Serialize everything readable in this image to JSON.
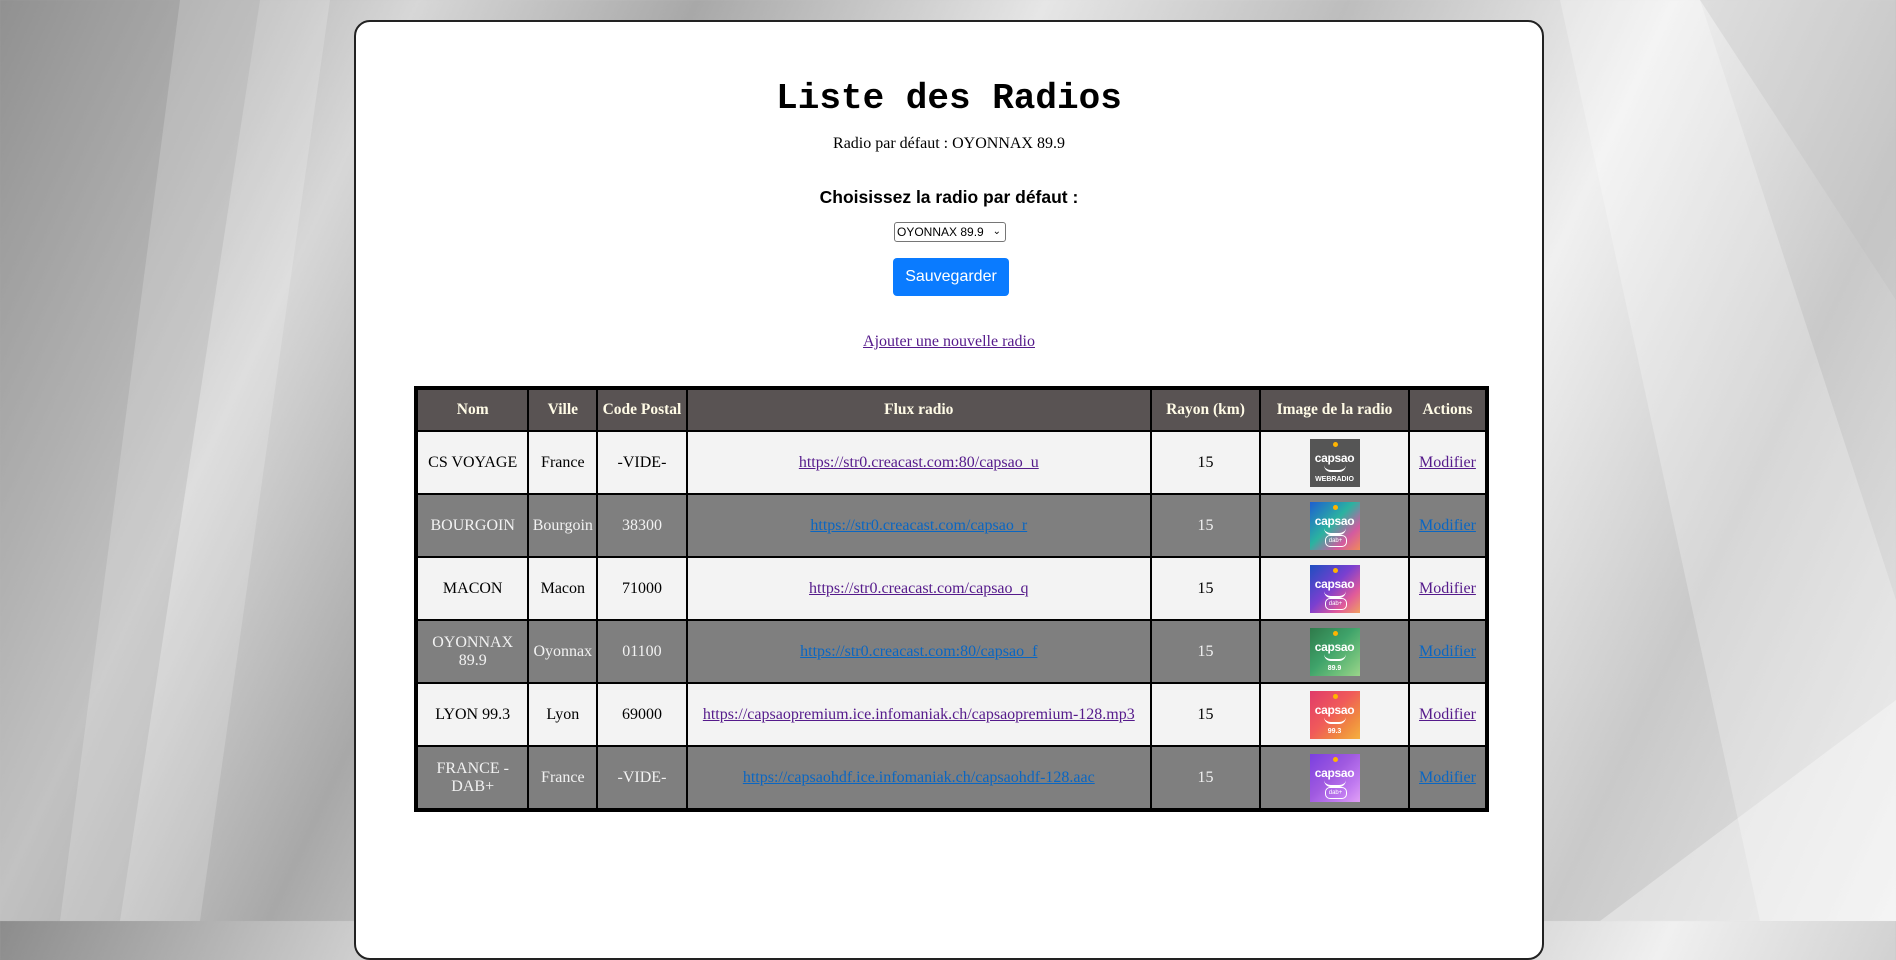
{
  "page": {
    "title": "Liste des Radios",
    "default_label": "Radio par défaut :",
    "default_value": "OYONNAX 89.9",
    "choose_label": "Choisissez la radio par défaut :",
    "select_value": "OYONNAX 89.9",
    "save_label": "Sauvegarder",
    "add_link": "Ajouter une nouvelle radio"
  },
  "table": {
    "headers": [
      "Nom",
      "Ville",
      "Code Postal",
      "Flux radio",
      "Rayon (km)",
      "Image de la radio",
      "Actions"
    ],
    "rows": [
      {
        "nom": "CS VOYAGE",
        "ville": "France",
        "code": "-VIDE-",
        "flux": "https://str0.creacast.com:80/capsao_u",
        "rayon": "15",
        "logo": {
          "name": "capsao",
          "sub": "WEBRADIO",
          "kind": "text",
          "bg": "#555555"
        },
        "action": "Modifier"
      },
      {
        "nom": "BOURGOIN",
        "ville": "Bourgoin",
        "code": "38300",
        "flux": "https://str0.creacast.com/capsao_r",
        "rayon": "15",
        "logo": {
          "name": "capsao",
          "sub": "dab+",
          "kind": "badge",
          "bg": "linear-gradient(135deg,#1e5fd0,#2bb3a0 45%,#d35aa0 75%,#f08a5a)"
        },
        "action": "Modifier"
      },
      {
        "nom": "MACON",
        "ville": "Macon",
        "code": "71000",
        "flux": "https://str0.creacast.com/capsao_q",
        "rayon": "15",
        "logo": {
          "name": "capsao",
          "sub": "dab+",
          "kind": "badge",
          "bg": "linear-gradient(135deg,#1e4fc0,#7a3fd0 45%,#e05a9a 75%,#f0a060)"
        },
        "action": "Modifier"
      },
      {
        "nom": "OYONNAX 89.9",
        "ville": "Oyonnax",
        "code": "01100",
        "flux": "https://str0.creacast.com:80/capsao_f",
        "rayon": "15",
        "logo": {
          "name": "capsao",
          "sub": "89.9",
          "kind": "text",
          "bg": "linear-gradient(135deg,#2f7a4a,#3fa36a 45%,#6fbf7a 75%,#9bd48a)"
        },
        "action": "Modifier"
      },
      {
        "nom": "LYON 99.3",
        "ville": "Lyon",
        "code": "69000",
        "flux": "https://capsaopremium.ice.infomaniak.ch/capsaopremium-128.mp3",
        "rayon": "15",
        "logo": {
          "name": "capsao",
          "sub": "99.3",
          "kind": "text",
          "bg": "linear-gradient(135deg,#e03a6a,#f05a5a 45%,#f08a40 75%,#f5b040)"
        },
        "action": "Modifier"
      },
      {
        "nom": "FRANCE - DAB+",
        "ville": "France",
        "code": "-VIDE-",
        "flux": "https://capsaohdf.ice.infomaniak.ch/capsaohdf-128.aac",
        "rayon": "15",
        "logo": {
          "name": "capsao",
          "sub": "dab+",
          "kind": "badge",
          "bg": "linear-gradient(135deg,#7a3fe0,#a05ae0 45%,#c07af0 75%,#e0a0f5)"
        },
        "action": "Modifier"
      }
    ]
  }
}
